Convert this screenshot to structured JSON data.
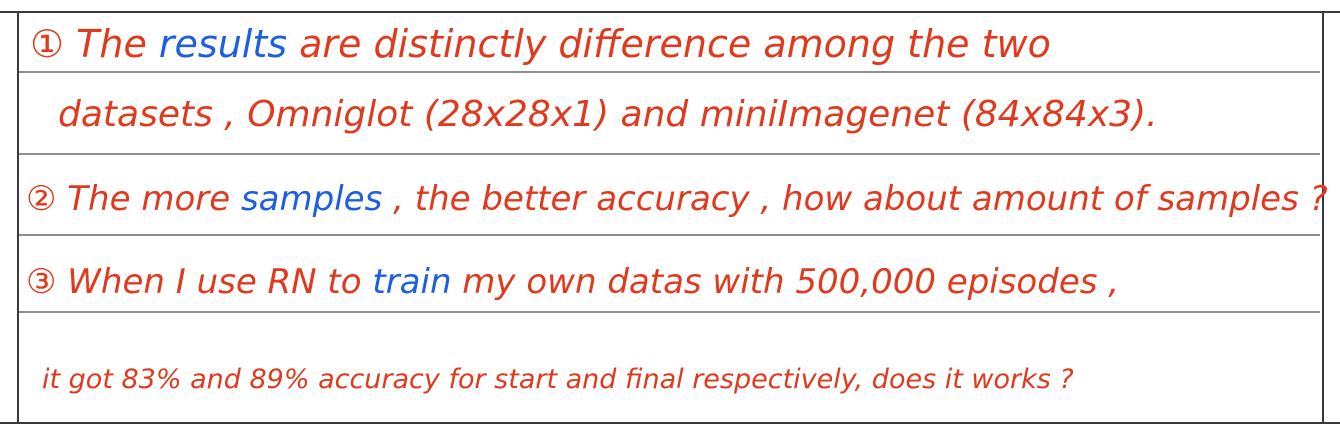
{
  "colors": {
    "ink_red": "#e03a1e",
    "ink_blue": "#1e5fe0",
    "rule": "#3a3a3a"
  },
  "lines": [
    {
      "pre": "① The ",
      "hl": "results",
      "post": " are distinctly difference among the two"
    },
    {
      "pre": "datasets , Omniglot (28x28x1) and miniImagenet (84x84x3).",
      "hl": "",
      "post": ""
    },
    {
      "pre": "② The more ",
      "hl": "samples",
      "post": " , the better accuracy , how about amount of samples ?"
    },
    {
      "pre": "③ When I use RN to ",
      "hl": "train",
      "post": " my own datas with 500,000 episodes ,"
    },
    {
      "pre": "it got 83% and 89% accuracy for start and final respectively, does it works ?",
      "hl": "",
      "post": ""
    }
  ]
}
